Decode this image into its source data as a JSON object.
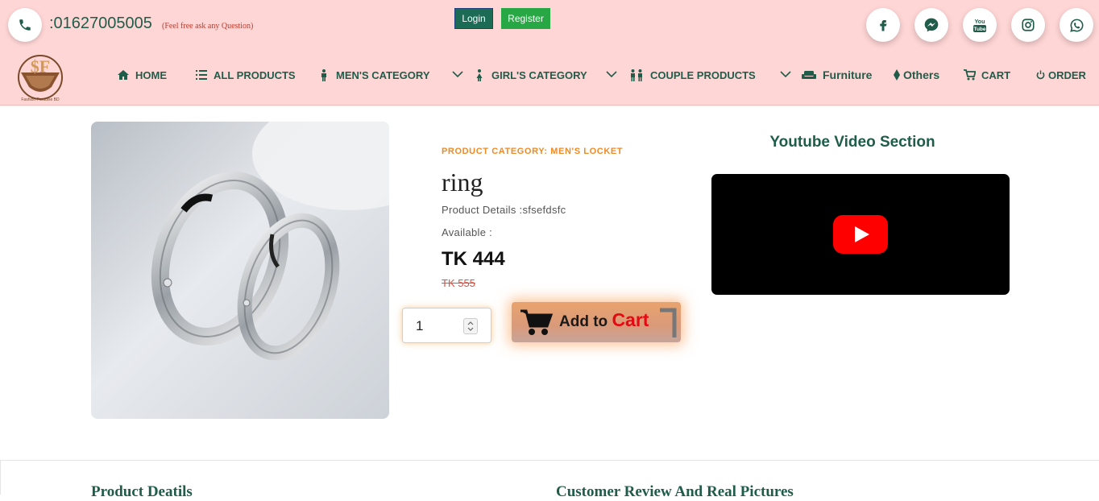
{
  "topbar": {
    "phone": ":01627005005",
    "phone_note": "(Feel free ask any Question)",
    "login_label": "Login",
    "register_label": "Register",
    "social_icons": [
      "facebook-icon",
      "messenger-icon",
      "youtube-icon",
      "instagram-icon",
      "whatsapp-icon"
    ]
  },
  "nav": {
    "items": [
      {
        "label": "HOME",
        "icon": "home-icon"
      },
      {
        "label": "ALL PRODUCTS",
        "icon": "list-icon"
      },
      {
        "label": "MEN'S CATEGORY",
        "icon": "male-icon"
      },
      {
        "label": "GIRL'S CATEGORY",
        "icon": "female-icon"
      },
      {
        "label": "COUPLE PRODUCTS",
        "icon": "couple-icon"
      },
      {
        "label": "Furniture",
        "icon": "sofa-icon"
      },
      {
        "label": "Others",
        "icon": "diamond-icon"
      },
      {
        "label": "CART",
        "icon": "cart-icon"
      },
      {
        "label": "ORDER",
        "icon": "power-icon"
      }
    ]
  },
  "logo": {
    "text": "Fashion Paradise BD"
  },
  "product": {
    "category": "PRODUCT CATEGORY: MEN'S LOCKET",
    "name": "ring",
    "details": "Product Details :sfsefdsfc",
    "available": "Available :",
    "price": "TK 444",
    "old_price": "TK 555",
    "quantity": "1",
    "cart_label_a": "Add to",
    "cart_label_b": "Cart"
  },
  "video": {
    "title": "Youtube Video Section"
  },
  "sections": {
    "details_title": "Product Deatils",
    "review_title": "Customer Review And Real Pictures"
  },
  "colors": {
    "brand_green": "#1f5c49",
    "top_bg": "#ffd6d6",
    "accent_orange": "#f08a24",
    "price_old": "#e74c3c"
  }
}
